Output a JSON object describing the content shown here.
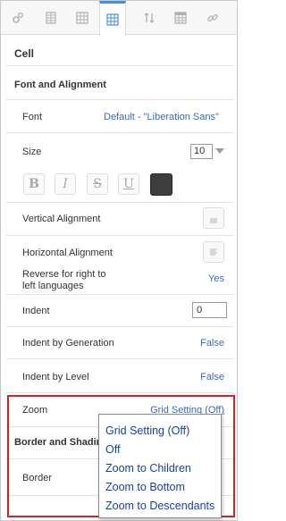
{
  "toolbar": {
    "icons": [
      {
        "name": "general-settings-icon"
      },
      {
        "name": "table-columns-icon"
      },
      {
        "name": "table-grid-icon"
      },
      {
        "name": "cell-grid-icon"
      },
      {
        "name": "sort-icon"
      },
      {
        "name": "table-header-icon"
      },
      {
        "name": "link-icon"
      }
    ],
    "active_icon": "cell-grid-icon"
  },
  "panel": {
    "title": "Cell"
  },
  "font_and_alignment": {
    "title": "Font and Alignment",
    "font_label": "Font",
    "font_value": "Default - \"Liberation Sans\"",
    "size_label": "Size",
    "size_value": "10",
    "format_buttons": [
      "B",
      "I",
      "S",
      "U"
    ],
    "text_color": "#3d3d3d",
    "vertical_alignment_label": "Vertical Alignment",
    "horizontal_alignment_label": "Horizontal Alignment",
    "reverse_label_line1": "Reverse for right to",
    "reverse_label_line2": "left languages",
    "reverse_value": "Yes",
    "indent_label": "Indent",
    "indent_value": "0",
    "indent_by_generation_label": "Indent by Generation",
    "indent_by_generation_value": "False",
    "indent_by_level_label": "Indent by Level",
    "indent_by_level_value": "False",
    "zoom_label": "Zoom",
    "zoom_value": "Grid Setting (Off)"
  },
  "border_and_shading": {
    "title": "Border and Shading",
    "border_label": "Border"
  },
  "zoom_dropdown": {
    "options": [
      "Grid Setting (Off)",
      "Off",
      "Zoom to Children",
      "Zoom to Bottom",
      "Zoom to Descendants"
    ]
  },
  "colors": {
    "accent": "#4a90d9",
    "link": "#3a6ab8",
    "highlight": "#d42222"
  }
}
